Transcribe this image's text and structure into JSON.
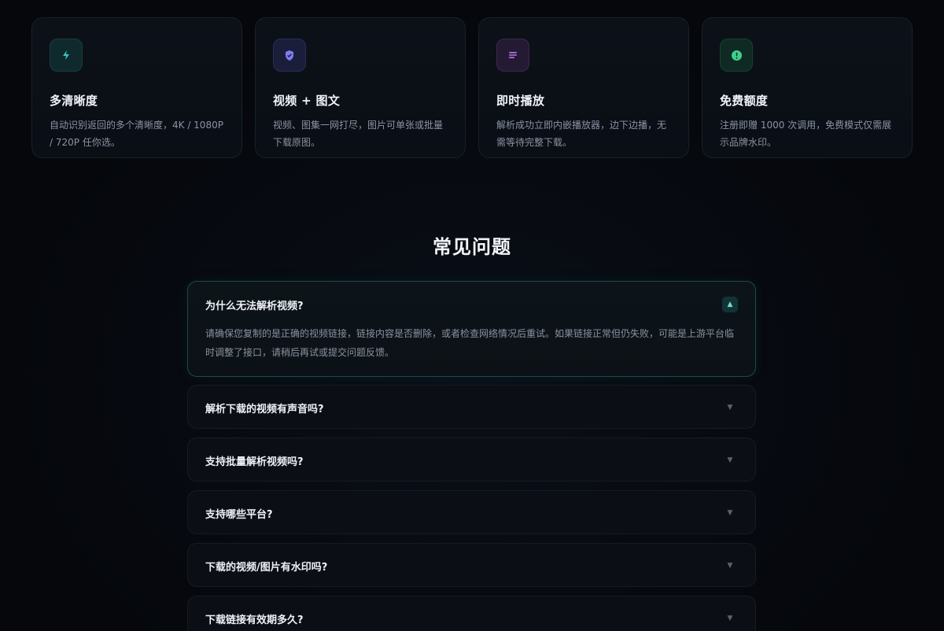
{
  "features": [
    {
      "icon": "lightning-icon",
      "color": "#39c6c0",
      "bg": "#0f2a2c",
      "title": "多清晰度",
      "desc": "自动识别返回的多个清晰度，4K / 1080P / 720P 任你选。"
    },
    {
      "icon": "shield-icon",
      "color": "#7f7df0",
      "bg": "#1b1e3a",
      "title": "视频 + 图文",
      "desc": "视频、图集一网打尽，图片可单张或批量下载原图。"
    },
    {
      "icon": "list-icon",
      "color": "#b27ae8",
      "bg": "#251a33",
      "title": "即时播放",
      "desc": "解析成功立即内嵌播放器，边下边播，无需等待完整下载。"
    },
    {
      "icon": "info-circle-icon",
      "color": "#3fcf8e",
      "bg": "#0f2a22",
      "title": "免费额度",
      "desc": "注册即赠 1000 次调用，免费模式仅需展示品牌水印。"
    }
  ],
  "faq": {
    "title": "常见问题",
    "items": [
      {
        "question": "为什么无法解析视频?",
        "answer": "请确保您复制的是正确的视频链接，链接内容是否删除，或者检查网络情况后重试。如果链接正常但仍失败，可能是上游平台临时调整了接口，请稍后再试或提交问题反馈。",
        "open": true,
        "toggle": "▲"
      },
      {
        "question": "解析下载的视频有声音吗?",
        "open": false,
        "toggle": "▼"
      },
      {
        "question": "支持批量解析视频吗?",
        "open": false,
        "toggle": "▼"
      },
      {
        "question": "支持哪些平台?",
        "open": false,
        "toggle": "▼"
      },
      {
        "question": "下载的视频/图片有水印吗?",
        "open": false,
        "toggle": "▼"
      },
      {
        "question": "下载链接有效期多久?",
        "open": false,
        "toggle": "▼"
      }
    ]
  }
}
